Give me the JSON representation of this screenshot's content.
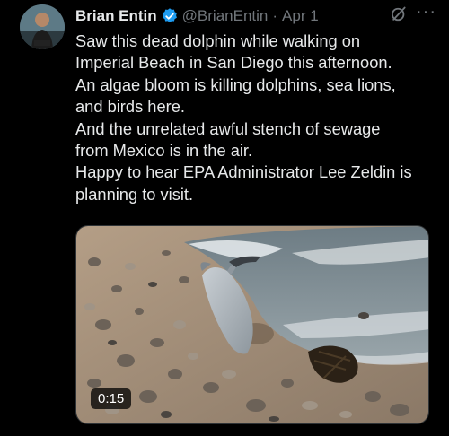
{
  "tweet": {
    "author_name": "Brian Entin",
    "handle": "@BrianEntin",
    "separator": "·",
    "date": "Apr 1",
    "text_lines": [
      "Saw this dead dolphin while walking on",
      "Imperial Beach in San Diego this afternoon.",
      "An algae bloom is killing dolphins, sea lions,",
      "and birds here.",
      "And the unrelated awful stench of sewage",
      "from Mexico is in the air.",
      "Happy to hear EPA Administrator Lee Zeldin is",
      "planning to visit."
    ],
    "more_label": "···",
    "video": {
      "duration": "0:15"
    }
  },
  "colors": {
    "background": "#000000",
    "text": "#e7e9ea",
    "secondary_text": "#71767b",
    "verified_badge": "#1d9bf0"
  },
  "icons": [
    "avatar",
    "verified-badge-icon",
    "grok-icon",
    "more-options-icon"
  ]
}
